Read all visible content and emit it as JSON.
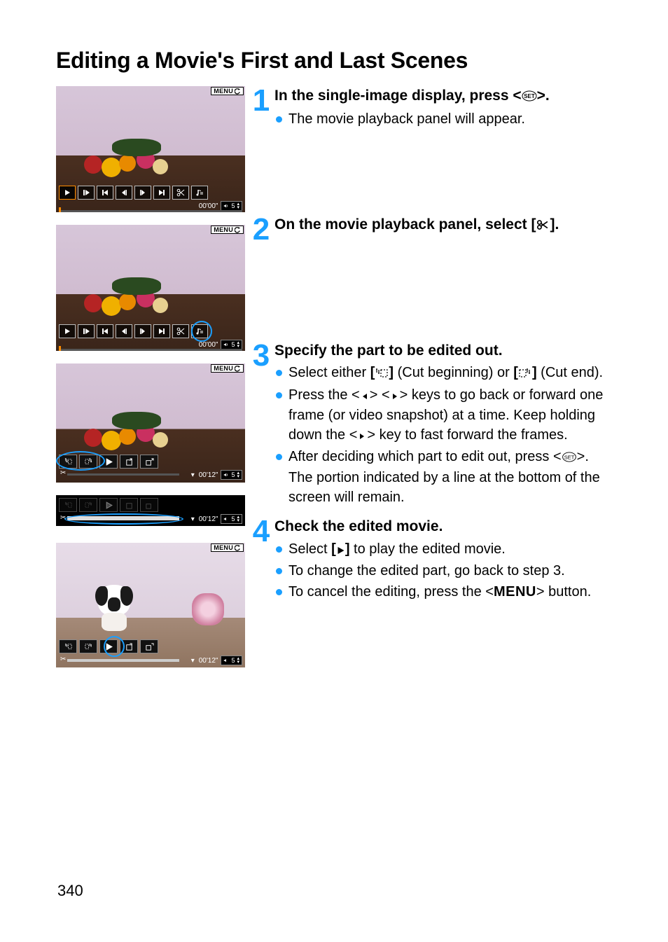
{
  "title": "Editing a Movie's First and Last Scenes",
  "page_number": "340",
  "menu_label": "MENU",
  "shots": {
    "s1": {
      "timecode": "00'00\"",
      "volume": "5"
    },
    "s2": {
      "timecode": "00'00\"",
      "volume": "5"
    },
    "s3": {
      "timecode": "00'12\"",
      "volume": "5"
    },
    "s4": {
      "timecode": "00'12\"",
      "volume": "5"
    },
    "s5": {
      "timecode": "00'12\"",
      "volume": "5"
    }
  },
  "steps": {
    "1": {
      "num": "1",
      "head_a": "In the single-image display, press <",
      "head_b": ">.",
      "b1": "The movie playback panel will appear."
    },
    "2": {
      "num": "2",
      "head_a": "On the movie playback panel, select [",
      "head_b": "]."
    },
    "3": {
      "num": "3",
      "head": "Specify the part to be edited out.",
      "b1a": "Select either ",
      "b1b": " (Cut beginning) or ",
      "b1c": " (Cut end).",
      "b2a": "Press the <",
      "b2b": "> <",
      "b2c": "> keys to go back or forward one frame (or video snapshot) at a time. Keep holding down the <",
      "b2d": "> key to fast forward the frames.",
      "b3a": "After deciding which part to edit out, press <",
      "b3b": ">. The portion indicated by a line at the bottom of the screen will remain."
    },
    "4": {
      "num": "4",
      "head": "Check the edited movie.",
      "b1a": "Select ",
      "b1b": " to play the edited movie.",
      "b2": "To change the edited part, go back to step 3.",
      "b3a": "To cancel the editing, press the <",
      "b3b": "> button.",
      "menu_word": "MENU"
    }
  }
}
